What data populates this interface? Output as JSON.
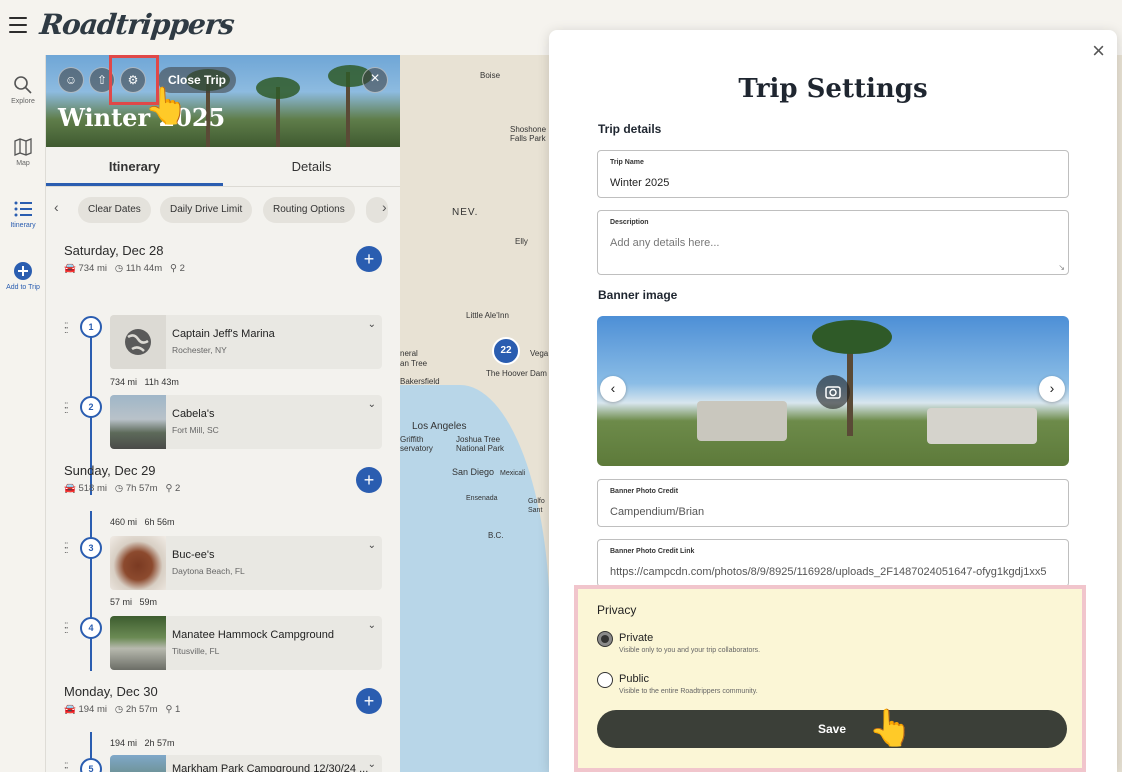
{
  "app": {
    "logo": "Roadtrippers"
  },
  "rail": [
    {
      "label": "Explore",
      "icon": "search-icon"
    },
    {
      "label": "Map",
      "icon": "map-icon"
    },
    {
      "label": "Itinerary",
      "icon": "list-icon"
    },
    {
      "label": "Add to Trip",
      "icon": "add-icon"
    }
  ],
  "panel": {
    "trip_title": "Winter 2025",
    "close_trip_label": "Close Trip",
    "tabs": [
      "Itinerary",
      "Details"
    ],
    "chips": [
      "Clear Dates",
      "Daily Drive Limit",
      "Routing Options"
    ],
    "days": [
      {
        "title": "Saturday, Dec 28",
        "distance": "734 mi",
        "duration": "11h 44m",
        "stops": "2"
      },
      {
        "title": "Sunday, Dec 29",
        "distance": "518 mi",
        "duration": "7h 57m",
        "stops": "2"
      },
      {
        "title": "Monday, Dec 30",
        "distance": "194 mi",
        "duration": "2h 57m",
        "stops": "1"
      }
    ],
    "stops": [
      {
        "num": "1",
        "name": "Captain Jeff's Marina",
        "location": "Rochester, NY"
      },
      {
        "num": "2",
        "name": "Cabela's",
        "location": "Fort Mill, SC"
      },
      {
        "num": "3",
        "name": "Buc-ee's",
        "location": "Daytona Beach, FL"
      },
      {
        "num": "4",
        "name": "Manatee Hammock Campground",
        "location": "Titusville, FL"
      },
      {
        "num": "5",
        "name": "Markham Park Campground 12/30/24 ..."
      }
    ],
    "segments": [
      {
        "distance": "734 mi",
        "duration": "11h 43m"
      },
      {
        "distance": "460 mi",
        "duration": "6h 56m"
      },
      {
        "distance": "57 mi",
        "duration": "59m"
      },
      {
        "distance": "194 mi",
        "duration": "2h 57m"
      }
    ]
  },
  "map": {
    "labels": [
      "Boise",
      "Shoshone Falls Park",
      "NEV.",
      "Elly",
      "Little Ale'Inn",
      "The Hoover Dam",
      "Vega",
      "neral",
      "an Tree",
      "Bakersfield",
      "Los Angeles",
      "Griffith",
      "servatory",
      "Joshua Tree National Park",
      "San Diego",
      "Mexicali",
      "Ensenada",
      "Golfo",
      "Sant",
      "B.C."
    ],
    "marker": "22"
  },
  "modal": {
    "title": "Trip Settings",
    "trip_details_label": "Trip details",
    "trip_name": {
      "label": "Trip Name",
      "value": "Winter 2025"
    },
    "description": {
      "label": "Description",
      "placeholder": "Add any details here..."
    },
    "banner_label": "Banner image",
    "photo_credit": {
      "label": "Banner Photo Credit",
      "value": "Campendium/Brian"
    },
    "photo_link": {
      "label": "Banner Photo Credit Link",
      "value": "https://campcdn.com/photos/8/9/8925/116928/uploads_2F1487024051647-ofyg1kgdj1xx5"
    },
    "privacy": {
      "title": "Privacy",
      "options": [
        {
          "label": "Private",
          "help": "Visible only to you and your trip collaborators.",
          "checked": true
        },
        {
          "label": "Public",
          "help": "Visible to the entire Roadtrippers community.",
          "checked": false
        }
      ],
      "save_label": "Save"
    }
  },
  "colors": {
    "accent": "#2a5db0",
    "save": "#3b3f38",
    "highlight_red": "#e04848",
    "privacy_bg": "#fbf6d6",
    "privacy_border": "#f1c5cc"
  }
}
